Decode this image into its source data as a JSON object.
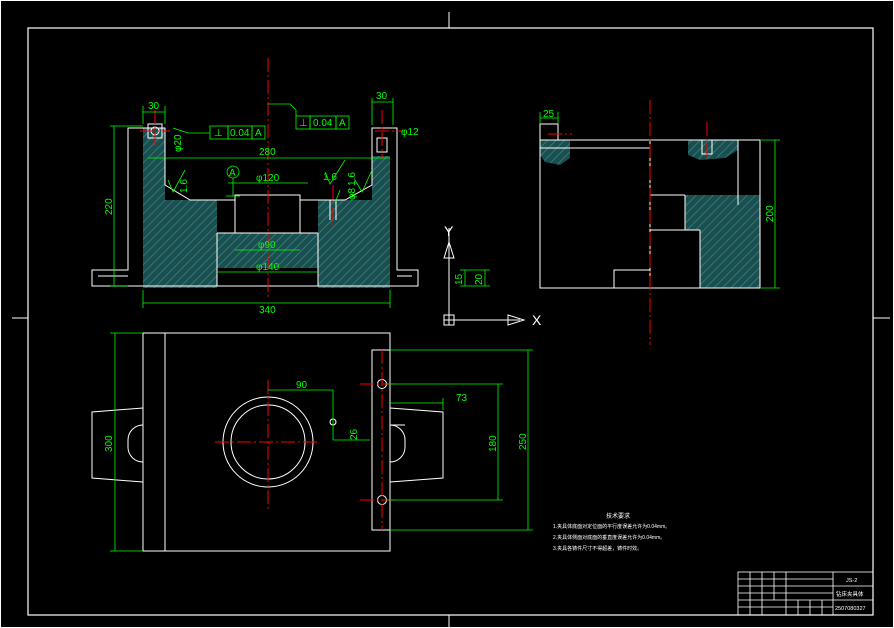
{
  "front_view": {
    "dims": {
      "top_left_width": "30",
      "top_right_width": "30",
      "left_hole_dia": "φ20",
      "right_hole_dia": "φ12",
      "inner_width": "280",
      "bore_dia": "φ120",
      "base_inner_dia": "φ90",
      "base_bottom_dia": "φ140",
      "overall_width": "340",
      "height": "220",
      "base_height_15": "15",
      "base_height_20": "20",
      "pin_dia": "φ8",
      "roughness_left": "1.6",
      "roughness_mid": "1.6",
      "roughness_right": "1.6"
    },
    "tolerance_left": {
      "symbol": "⊥",
      "value": "0.04",
      "datum": "A"
    },
    "tolerance_right": {
      "symbol": "⊥",
      "value": "0.04",
      "datum": "A"
    },
    "datum_label": "A"
  },
  "side_view": {
    "dims": {
      "top_width": "25",
      "height": "200"
    }
  },
  "top_view": {
    "dims": {
      "dist_90": "90",
      "dist_73": "73",
      "dist_26": "26",
      "height_300": "300",
      "height_180": "180",
      "height_250": "250"
    }
  },
  "axes": {
    "y_label": "Y",
    "x_label": "X"
  },
  "notes": {
    "title": "技术要求",
    "lines": [
      "1.夹具体底面对定位面的平行度误差允许为0.04mm。",
      "2.夹具体侧面对底面的垂直度误差允许为0.04mm。",
      "3.夹具各铸件尺寸不得超差，铸件时效。"
    ]
  },
  "title_block": {
    "part_code": "JS-2",
    "part_name": "钻床夹具体",
    "drawing_no": "2507080327"
  }
}
